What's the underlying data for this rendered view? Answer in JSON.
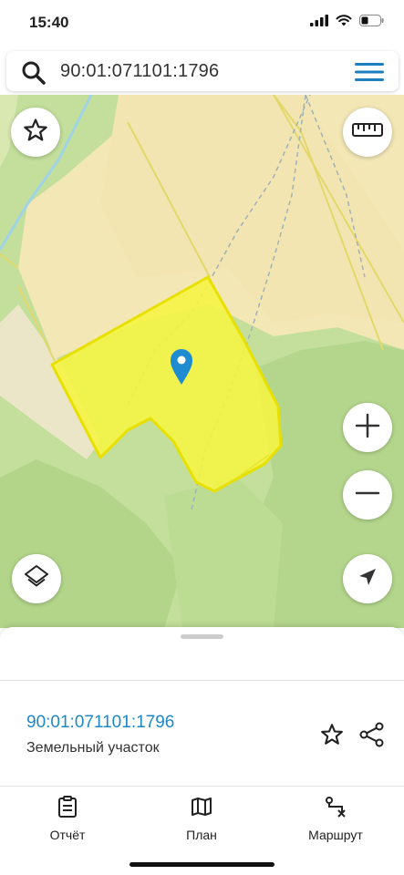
{
  "status": {
    "time": "15:40"
  },
  "search": {
    "query": "90:01:071101:1796"
  },
  "icons": {
    "search": "search-icon",
    "menu": "hamburger-menu-icon",
    "favorite": "star-icon",
    "ruler": "ruler-icon",
    "zoom_in": "plus-icon",
    "zoom_out": "minus-icon",
    "layers": "layers-icon",
    "locate": "navigation-arrow-icon",
    "pin": "map-pin-icon",
    "share": "share-icon",
    "report": "clipboard-icon",
    "plan": "map-icon",
    "route": "route-icon"
  },
  "colors": {
    "accent": "#1e88c7",
    "parcel_fill": "#f6f542",
    "parcel_border": "#e8e000",
    "map_green": "#bfdc94",
    "map_beige": "#f3e7b6"
  },
  "parcel": {
    "cadastral_number": "90:01:071101:1796",
    "type": "Земельный участок"
  },
  "tabs": [
    {
      "label": "Отчёт"
    },
    {
      "label": "План"
    },
    {
      "label": "Маршрут"
    }
  ]
}
